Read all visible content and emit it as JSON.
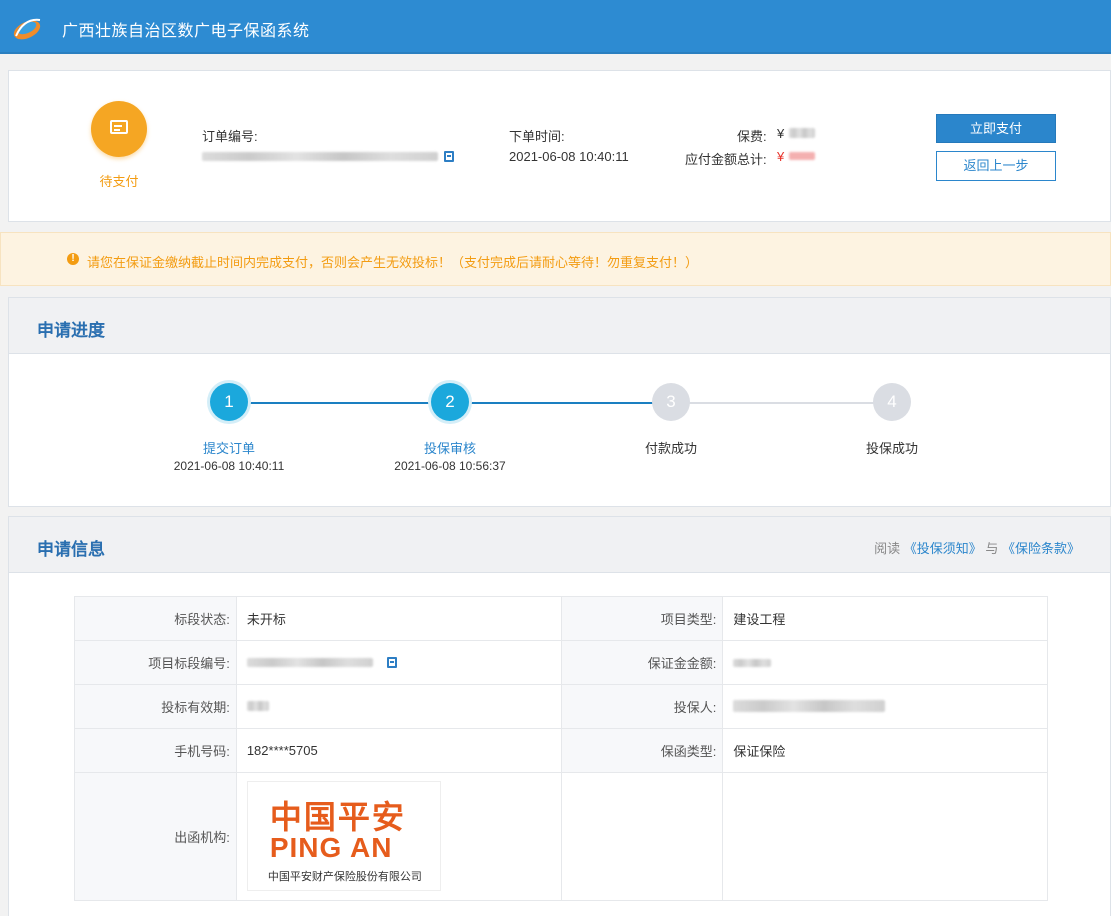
{
  "app": {
    "title": "广西壮族自治区数广电子保函系统"
  },
  "order": {
    "status": "待支付",
    "order_no_label": "订单编号:",
    "order_time_label": "下单时间:",
    "order_time": "2021-06-08 10:40:11",
    "premium_label": "保费:",
    "premium_currency": "¥",
    "total_label": "应付金额总计:",
    "total_currency": "¥",
    "pay_button": "立即支付",
    "back_button": "返回上一步"
  },
  "notice": {
    "icon": "!",
    "text": "请您在保证金缴纳截止时间内完成支付，否则会产生无效投标！（支付完成后请耐心等待！勿重复支付！）"
  },
  "progress": {
    "title": "申请进度",
    "steps": [
      {
        "num": "1",
        "name": "提交订单",
        "time": "2021-06-08 10:40:11",
        "state": "active"
      },
      {
        "num": "2",
        "name": "投保审核",
        "time": "2021-06-08 10:56:37",
        "state": "active"
      },
      {
        "num": "3",
        "name": "付款成功",
        "time": "",
        "state": "todo"
      },
      {
        "num": "4",
        "name": "投保成功",
        "time": "",
        "state": "todo"
      }
    ]
  },
  "info": {
    "title": "申请信息",
    "read_prefix": "阅读",
    "notice_link": "《投保须知》",
    "read_and": "与",
    "terms_link": "《保险条款》",
    "rows": {
      "section_status_label": "标段状态:",
      "section_status": "未开标",
      "project_type_label": "项目类型:",
      "project_type": "建设工程",
      "section_no_label": "项目标段编号:",
      "deposit_label": "保证金金额:",
      "bid_validity_label": "投标有效期:",
      "insured_label": "投保人:",
      "phone_label": "手机号码:",
      "phone": "182****5705",
      "guarantee_type_label": "保函类型:",
      "guarantee_type": "保证保险",
      "issuer_label": "出函机构:"
    },
    "issuer": {
      "logo_cn": "中国平安",
      "logo_en": "PING AN",
      "company": "中国平安财产保险股份有限公司"
    }
  },
  "colors": {
    "header": "#2d8bd2",
    "accent": "#2b86cc",
    "pending": "#f5a623",
    "step_active": "#1ba8dc",
    "step_todo": "#dadde3",
    "brand_pingan": "#e65c1c"
  }
}
